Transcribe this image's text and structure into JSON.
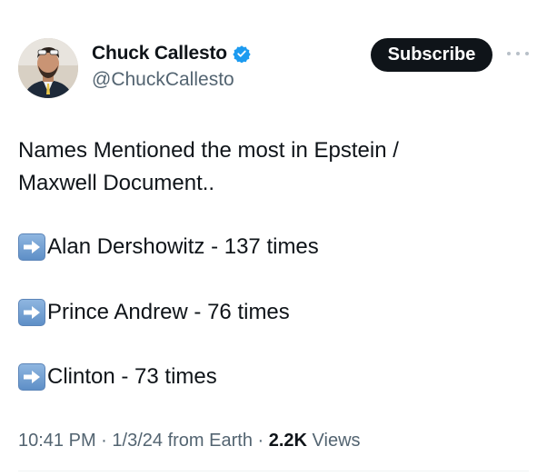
{
  "author": {
    "display_name": "Chuck Callesto",
    "handle": "@ChuckCallesto",
    "verified_icon": "verified-badge-icon",
    "verified_color": "#1d9bf0"
  },
  "header": {
    "subscribe_label": "Subscribe",
    "more_icon": "more-options-icon"
  },
  "tweet": {
    "intro_lines": [
      "Names Mentioned the most in Epstein /",
      "Maxwell Document.."
    ],
    "mentions": [
      {
        "icon": "right-arrow-emoji-icon",
        "text": "Alan Dershowitz - 137 times"
      },
      {
        "icon": "right-arrow-emoji-icon",
        "text": "Prince Andrew - 76 times"
      },
      {
        "icon": "right-arrow-emoji-icon",
        "text": "Clinton - 73 times"
      }
    ]
  },
  "meta": {
    "time": "10:41 PM",
    "date": "1/3/24",
    "location": "from Earth",
    "views_count": "2.2K",
    "views_label": "Views",
    "separator": "·"
  }
}
